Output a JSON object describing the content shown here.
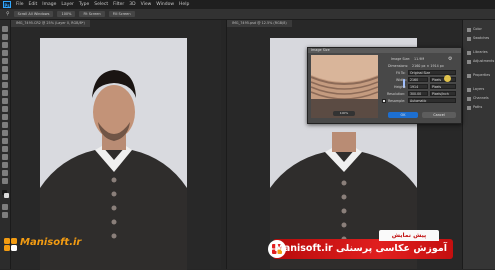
{
  "menubar": {
    "logo": "Ps",
    "items": [
      "File",
      "Edit",
      "Image",
      "Layer",
      "Type",
      "Select",
      "Filter",
      "3D",
      "View",
      "Window",
      "Help"
    ]
  },
  "optionbar": {
    "buttons": [
      "Scroll All Windows",
      "100%",
      "Fit Screen",
      "Fill Screen"
    ]
  },
  "documents": [
    {
      "tab": "IMG_7495.CR2 @ 25% (Layer 0, RGB/8*)"
    },
    {
      "tab": "IMG_7495.psd @ 12.5% (RGB/8)"
    }
  ],
  "right_panel": {
    "labels": [
      "Color",
      "Swatches",
      "Libraries",
      "Adjustments",
      "Properties",
      "Layers",
      "Channels",
      "Paths"
    ]
  },
  "image_size_dialog": {
    "title": "Image Size",
    "image_size_label": "Image Size:",
    "image_size_value": "11.9M",
    "dimensions_label": "Dimensions:",
    "dimensions_value": "2160 px × 1914 px",
    "fit_to_label": "Fit To:",
    "fit_to_value": "Original Size",
    "width_label": "Width:",
    "width_value": "2160",
    "height_label": "Height:",
    "height_value": "1914",
    "resolution_label": "Resolution:",
    "resolution_value": "300.00",
    "unit_px": "Pixels",
    "unit_res": "Pixels/Inch",
    "resample_label": "Resample:",
    "resample_value": "Automatic",
    "zoom_label": "100%",
    "ok_label": "OK",
    "cancel_label": "Cancel"
  },
  "watermark": {
    "text": "Manisoft.ir"
  },
  "banner": {
    "top_label": "پیش نمایش",
    "main_text": "آموزش عکاسی پرسنلی Manisoft.ir"
  },
  "colors": {
    "accent_orange": "#f39c12",
    "banner_red": "#e11f1f",
    "ps_blue": "#31a8ff"
  }
}
